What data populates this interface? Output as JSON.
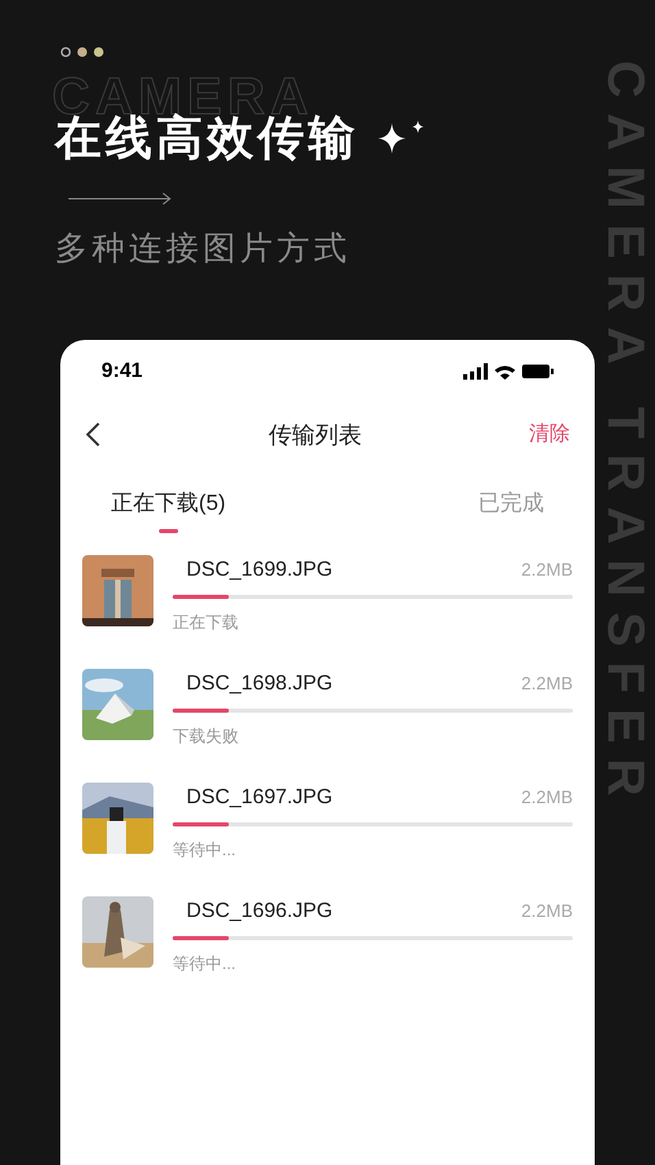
{
  "header": {
    "ghost_word": "CAMERA",
    "title": "在线高效传输",
    "subtitle": "多种连接图片方式",
    "side_text": "CAMERA TRANSFER"
  },
  "phone": {
    "status_bar": {
      "time": "9:41"
    },
    "nav": {
      "title": "传输列表",
      "action": "清除"
    },
    "tabs": [
      {
        "label": "正在下载(5)",
        "selected": true
      },
      {
        "label": "已完成",
        "selected": false
      }
    ],
    "files": [
      {
        "name": "DSC_1699.JPG",
        "size": "2.2MB",
        "level": 0.14,
        "status": "正在下载"
      },
      {
        "name": "DSC_1698.JPG",
        "size": "2.2MB",
        "level": 0.14,
        "status": "下载失败"
      },
      {
        "name": "DSC_1697.JPG",
        "size": "2.2MB",
        "level": 0.14,
        "status": "等待中..."
      },
      {
        "name": "DSC_1696.JPG",
        "size": "2.2MB",
        "level": 0.14,
        "status": "等待中..."
      }
    ]
  }
}
